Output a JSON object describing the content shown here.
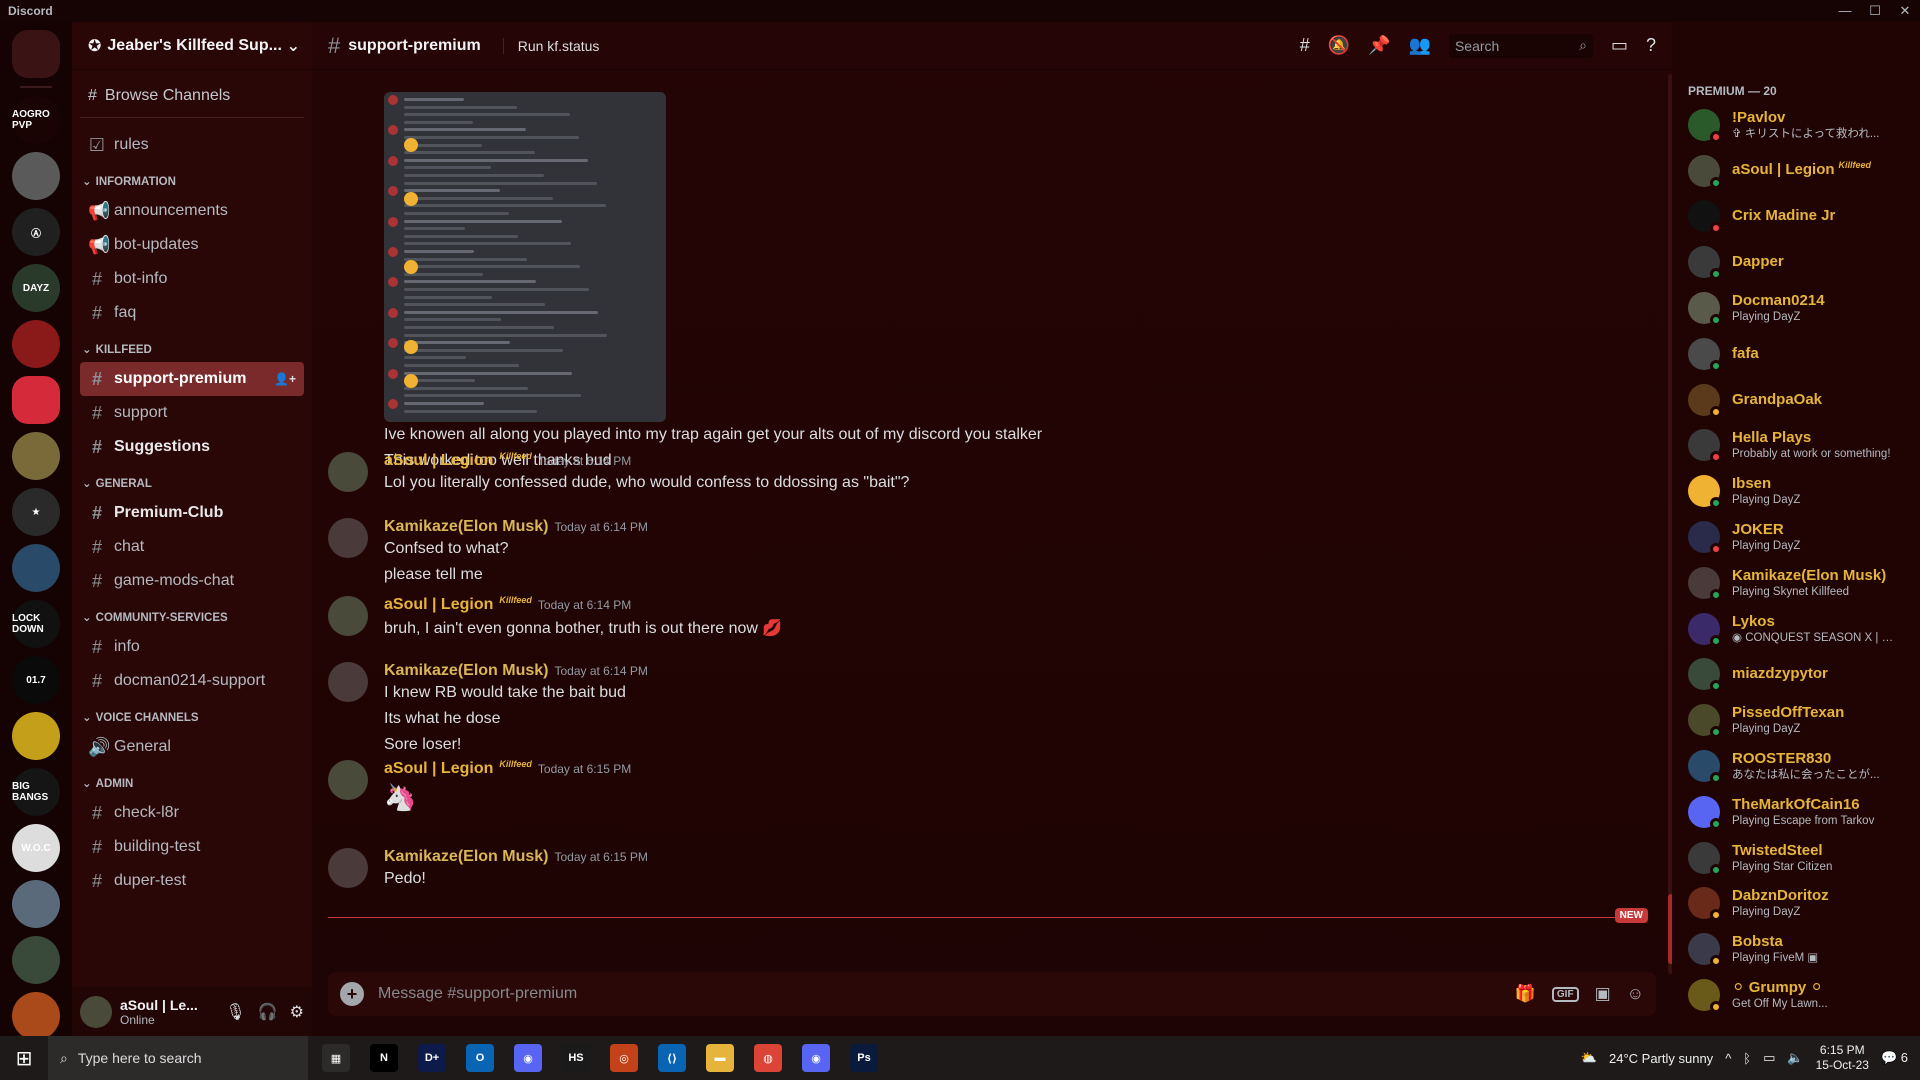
{
  "window": {
    "title": "Discord",
    "controls": [
      "—",
      "☐",
      "✕"
    ]
  },
  "guilds": [
    {
      "label": "",
      "color": "#3a1414",
      "kind": "home"
    },
    {
      "label": "AOGRO PVP",
      "color": "#1a0303"
    },
    {
      "label": "",
      "color": "#5a5a5a"
    },
    {
      "label": "Ⓐ",
      "color": "#202020"
    },
    {
      "label": "DAYZ",
      "color": "#2a3a2a"
    },
    {
      "label": "",
      "color": "#8a1a1a"
    },
    {
      "label": "",
      "color": "#d42a3a",
      "kind": "sel"
    },
    {
      "label": "",
      "color": "#7a6a3a"
    },
    {
      "label": "★",
      "color": "#2a2a2a"
    },
    {
      "label": "",
      "color": "#2a4a6a"
    },
    {
      "label": "LOCK DOWN",
      "color": "#111111"
    },
    {
      "label": "01.7",
      "color": "#0a0a0a"
    },
    {
      "label": "",
      "color": "#c4a01a"
    },
    {
      "label": "BIG BANGS",
      "color": "#151515"
    },
    {
      "label": "W.O.C",
      "color": "#dddddd"
    },
    {
      "label": "",
      "color": "#5a6a7a"
    },
    {
      "label": "",
      "color": "#3a4a3a"
    },
    {
      "label": "",
      "color": "#aa4a1a"
    }
  ],
  "server": {
    "name": "Jeaber's Killfeed Sup...",
    "browse": "Browse Channels",
    "top_channels": [
      {
        "name": "rules",
        "icon": "rules-icon"
      }
    ],
    "categories": [
      {
        "name": "INFORMATION",
        "channels": [
          {
            "name": "announcements",
            "icon": "megaphone-icon"
          },
          {
            "name": "bot-updates",
            "icon": "megaphone-icon"
          },
          {
            "name": "bot-info",
            "icon": "hash-icon"
          },
          {
            "name": "faq",
            "icon": "hash-icon"
          }
        ]
      },
      {
        "name": "KILLFEED",
        "channels": [
          {
            "name": "support-premium",
            "icon": "hash-icon",
            "active": true
          },
          {
            "name": "support",
            "icon": "hash-icon"
          },
          {
            "name": "Suggestions",
            "icon": "hash-icon",
            "bold": true
          }
        ]
      },
      {
        "name": "GENERAL",
        "channels": [
          {
            "name": "Premium-Club",
            "icon": "hash-icon",
            "bold": true
          },
          {
            "name": "chat",
            "icon": "hash-icon"
          },
          {
            "name": "game-mods-chat",
            "icon": "hash-icon"
          }
        ]
      },
      {
        "name": "COMMUNITY-SERVICES",
        "channels": [
          {
            "name": "info",
            "icon": "hash-icon"
          },
          {
            "name": "docman0214-support",
            "icon": "hash-icon"
          }
        ]
      },
      {
        "name": "VOICE CHANNELS",
        "channels": [
          {
            "name": "General",
            "icon": "speaker-icon"
          }
        ]
      },
      {
        "name": "ADMIN",
        "channels": [
          {
            "name": "check-l8r",
            "icon": "hash-icon"
          },
          {
            "name": "building-test",
            "icon": "hash-icon"
          },
          {
            "name": "duper-test",
            "icon": "hash-icon"
          }
        ]
      }
    ]
  },
  "current_user": {
    "name": "aSoul | Le...",
    "status": "Online"
  },
  "channel_header": {
    "name": "support-premium",
    "topic": "Run kf.status",
    "search_placeholder": "Search"
  },
  "messages": {
    "orphan_lines": [
      "Ive knowen all along you played into my trap again get your alts out of my discord you stalker",
      "This worked too well thanks bud"
    ],
    "groups": [
      {
        "author": "aSoul | Legion",
        "tag": "Killfeed",
        "time": "Today at 6:14 PM",
        "lines": [
          "Lol you literally confessed dude, who would confess to ddossing as \"bait\"?"
        ]
      },
      {
        "author": "Kamikaze(Elon Musk)",
        "tag": "",
        "time": "Today at 6:14 PM",
        "lines": [
          "Confsed to what?",
          "please tell me"
        ]
      },
      {
        "author": "aSoul | Legion",
        "tag": "Killfeed",
        "time": "Today at 6:14 PM",
        "lines": [
          "bruh, I ain't even gonna bother, truth is out there now 💋"
        ]
      },
      {
        "author": "Kamikaze(Elon Musk)",
        "tag": "",
        "time": "Today at 6:14 PM",
        "lines": [
          "I knew RB would take the bait bud",
          "Its what he dose",
          "Sore loser!"
        ]
      },
      {
        "author": "aSoul | Legion",
        "tag": "Killfeed",
        "time": "Today at 6:15 PM",
        "lines": [
          ""
        ]
      },
      {
        "author": "Kamikaze(Elon Musk)",
        "tag": "",
        "time": "Today at 6:15 PM",
        "lines": [
          "Pedo!"
        ]
      }
    ],
    "new_badge": "NEW"
  },
  "composer": {
    "placeholder": "Message #support-premium",
    "gif": "GIF"
  },
  "members": {
    "category": "PREMIUM — 20",
    "list": [
      {
        "name": "!Pavlov",
        "activity": "✞ キリストによって救われ...",
        "status_color": "#f23f43",
        "avatar": "#2a5a2a"
      },
      {
        "name": "aSoul | Legion",
        "tag": "Killfeed",
        "activity": "",
        "status_color": "#23a55a",
        "avatar": "#4a4a3a"
      },
      {
        "name": "Crix Madine Jr",
        "activity": "",
        "status_color": "#f23f43",
        "avatar": "#111111"
      },
      {
        "name": "Dapper",
        "activity": "",
        "status_color": "#23a55a",
        "avatar": "#3a3a3a"
      },
      {
        "name": "Docman0214",
        "activity": "Playing DayZ",
        "status_color": "#23a55a",
        "avatar": "#5a5a4a"
      },
      {
        "name": "fafa",
        "activity": "",
        "status_color": "#23a55a",
        "avatar": "#4a4a4a"
      },
      {
        "name": "GrandpaOak",
        "activity": "",
        "status_color": "#f0b232",
        "avatar": "#5a3a1a"
      },
      {
        "name": "Hella Plays",
        "activity": "Probably at work or something!",
        "status_color": "#f23f43",
        "avatar": "#3a3a3a"
      },
      {
        "name": "Ibsen",
        "activity": "Playing DayZ",
        "status_color": "#23a55a",
        "avatar": "#f0b232"
      },
      {
        "name": "JOKER",
        "activity": "Playing DayZ",
        "status_color": "#f23f43",
        "avatar": "#2a2a4a"
      },
      {
        "name": "Kamikaze(Elon Musk)",
        "activity": "Playing Skynet Killfeed",
        "status_color": "#23a55a",
        "avatar": "#4a3a3a"
      },
      {
        "name": "Lykos",
        "activity": "◉ CONQUEST SEASON X | O...",
        "status_color": "#23a55a",
        "avatar": "#3a2a6a"
      },
      {
        "name": "miazdzypytor",
        "activity": "",
        "status_color": "#23a55a",
        "avatar": "#3a4a3a"
      },
      {
        "name": "PissedOffTexan",
        "activity": "Playing DayZ",
        "status_color": "#23a55a",
        "avatar": "#4a4a2a"
      },
      {
        "name": "ROOSTER830",
        "activity": "あなたは私に会ったことが...",
        "status_color": "#23a55a",
        "avatar": "#2a4a6a"
      },
      {
        "name": "TheMarkOfCain16",
        "activity": "Playing Escape from Tarkov",
        "status_color": "#23a55a",
        "avatar": "#5865f2"
      },
      {
        "name": "TwistedSteel",
        "activity": "Playing Star Citizen",
        "status_color": "#23a55a",
        "avatar": "#3a3a3a"
      },
      {
        "name": "DabznDoritoz",
        "activity": "Playing DayZ",
        "status_color": "#f0b232",
        "avatar": "#6a2a1a"
      },
      {
        "name": "Bobsta",
        "activity": "Playing FiveM ▣",
        "status_color": "#f0b232",
        "avatar": "#3a3a4a"
      },
      {
        "name": "⚪ Grumpy ⚪",
        "activity": "Get Off My Lawn...",
        "status_color": "#f0b232",
        "avatar": "#6a5a1a"
      }
    ]
  },
  "taskbar": {
    "search_placeholder": "Type here to search",
    "apps": [
      {
        "label": "▦",
        "color": "#2d2a2a"
      },
      {
        "label": "N",
        "color": "#000000"
      },
      {
        "label": "D+",
        "color": "#0e1a4a"
      },
      {
        "label": "O",
        "color": "#0a64b4"
      },
      {
        "label": "◉",
        "color": "#5865f2"
      },
      {
        "label": "HS",
        "color": "#1a1a1a"
      },
      {
        "label": "◎",
        "color": "#c4421a"
      },
      {
        "label": "⟨⟩",
        "color": "#0a64b4"
      },
      {
        "label": "▬",
        "color": "#e6b43a"
      },
      {
        "label": "◍",
        "color": "#db4437"
      },
      {
        "label": "◉",
        "color": "#5865f2"
      },
      {
        "label": "Ps",
        "color": "#0a1a3a"
      }
    ],
    "weather": "24°C  Partly sunny",
    "time": "6:15 PM",
    "date": "15-Oct-23",
    "notifications": "6"
  }
}
